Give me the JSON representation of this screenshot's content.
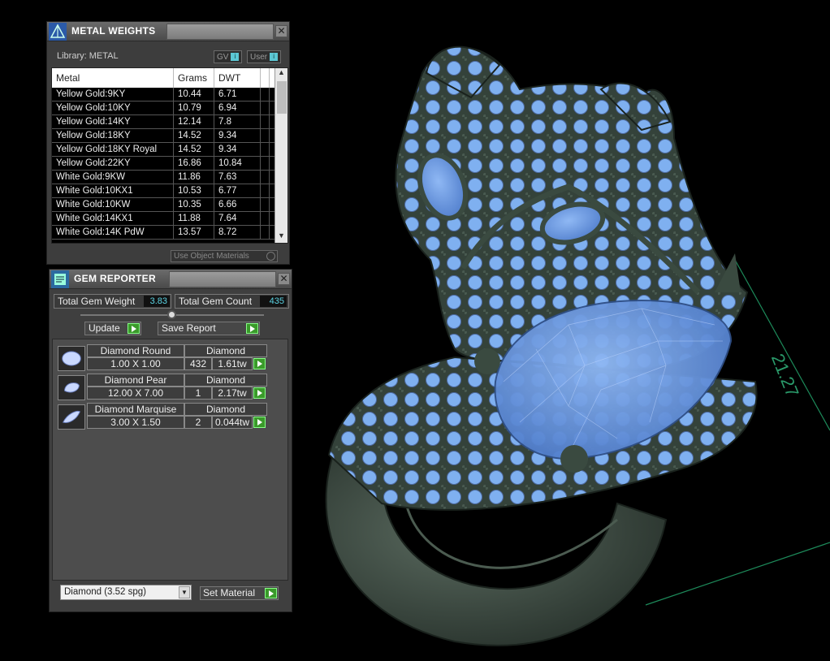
{
  "viewport": {
    "dimension_label": "21.27"
  },
  "metal_weights": {
    "title": "METAL WEIGHTS",
    "library_label": "Library: METAL",
    "gv_label": "GV",
    "user_label": "User",
    "columns": [
      "Metal",
      "Grams",
      "DWT"
    ],
    "rows": [
      {
        "metal": "Yellow Gold:9KY",
        "grams": "10.44",
        "dwt": "6.71"
      },
      {
        "metal": "Yellow Gold:10KY",
        "grams": "10.79",
        "dwt": "6.94"
      },
      {
        "metal": "Yellow Gold:14KY",
        "grams": "12.14",
        "dwt": "7.8"
      },
      {
        "metal": "Yellow Gold:18KY",
        "grams": "14.52",
        "dwt": "9.34"
      },
      {
        "metal": "Yellow Gold:18KY Royal",
        "grams": "14.52",
        "dwt": "9.34"
      },
      {
        "metal": "Yellow Gold:22KY",
        "grams": "16.86",
        "dwt": "10.84"
      },
      {
        "metal": "White Gold:9KW",
        "grams": "11.86",
        "dwt": "7.63"
      },
      {
        "metal": "White Gold:10KX1",
        "grams": "10.53",
        "dwt": "6.77"
      },
      {
        "metal": "White Gold:10KW",
        "grams": "10.35",
        "dwt": "6.66"
      },
      {
        "metal": "White Gold:14KX1",
        "grams": "11.88",
        "dwt": "7.64"
      },
      {
        "metal": "White Gold:14K PdW",
        "grams": "13.57",
        "dwt": "8.72"
      }
    ],
    "use_object_materials": "Use Object Materials"
  },
  "gem_reporter": {
    "title": "GEM REPORTER",
    "total_weight_label": "Total Gem Weight",
    "total_weight_value": "3.83",
    "total_count_label": "Total Gem Count",
    "total_count_value": "435",
    "update_label": "Update",
    "save_report_label": "Save Report",
    "gems": [
      {
        "name": "Diamond Round",
        "material": "Diamond",
        "size": "1.00 X 1.00",
        "count": "432",
        "weight": "1.61tw"
      },
      {
        "name": "Diamond Pear",
        "material": "Diamond",
        "size": "12.00 X 7.00",
        "count": "1",
        "weight": "2.17tw"
      },
      {
        "name": "Diamond Marquise",
        "material": "Diamond",
        "size": "3.00 X 1.50",
        "count": "2",
        "weight": "0.044tw"
      }
    ],
    "material_select": "Diamond    (3.52 spg)",
    "set_material_label": "Set Material"
  },
  "colors": {
    "background": "#000000",
    "metal": "#3a4a40",
    "gem": "#7fb0f0",
    "accent_value": "#5cd4e4",
    "go_button": "#3a9a2a"
  }
}
